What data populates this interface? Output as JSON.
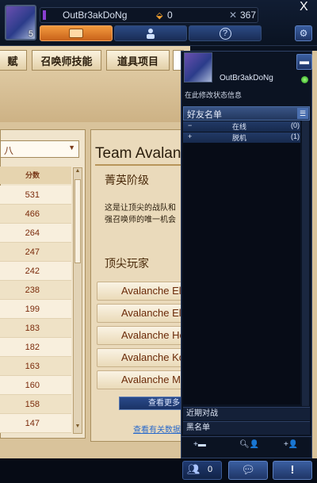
{
  "header": {
    "summoner_name": "OutBr3akDoNg",
    "level": "5",
    "rp": "0",
    "ip": "367",
    "rp_icon": "coin-icon",
    "ip_icon": "ip-icon",
    "store_icon": "store-chest-icon",
    "profile_icon": "person-icon",
    "help_icon": "?",
    "settings_icon": "gear-icon",
    "close_icon": "X"
  },
  "tabs": [
    {
      "label": "赋"
    },
    {
      "label": "召唤师技能"
    },
    {
      "label": "道具项目"
    }
  ],
  "dropdown": {
    "value": "八"
  },
  "leaderboard": {
    "column_header": "分数",
    "scores": [
      "531",
      "466",
      "264",
      "247",
      "242",
      "238",
      "199",
      "183",
      "182",
      "163",
      "160",
      "158",
      "147"
    ]
  },
  "team_panel": {
    "title": "Team Avalanche",
    "elite_heading": "菁英阶级",
    "description_line1": "这是让顶尖的战队和",
    "description_line2": "强召唤师的唯一机会",
    "top_players_heading": "顶尖玩家",
    "players": [
      "Avalanche Eli",
      "Avalanche Ell",
      "Avalanche He",
      "Avalanche Ko",
      "Avalanche Mo"
    ],
    "view_more_label": "查看更多",
    "link_label": "查看有关数据"
  },
  "friends_panel": {
    "name": "OutBr3akDoNg",
    "status_text": "在此修改状态信息",
    "status_color": "#3ac21e",
    "list_title": "好友名单",
    "groups": [
      {
        "sign": "−",
        "name": "在线",
        "count": "(0)"
      },
      {
        "sign": "+",
        "name": "脱机",
        "count": "(1)"
      }
    ],
    "recent_label": "近期对战",
    "blacklist_label": "黑名单",
    "tools": {
      "add_group": "+▬",
      "search": "🔍︎👤",
      "add_friend": "+👤"
    }
  },
  "bottom_bar": {
    "people_count": "0",
    "chat_icon": "chat-bubbles-icon",
    "alert_label": "!"
  },
  "colors": {
    "accent_orange": "#e8862a",
    "panel_blue": "#22375e",
    "parchment": "#d9c39b"
  }
}
